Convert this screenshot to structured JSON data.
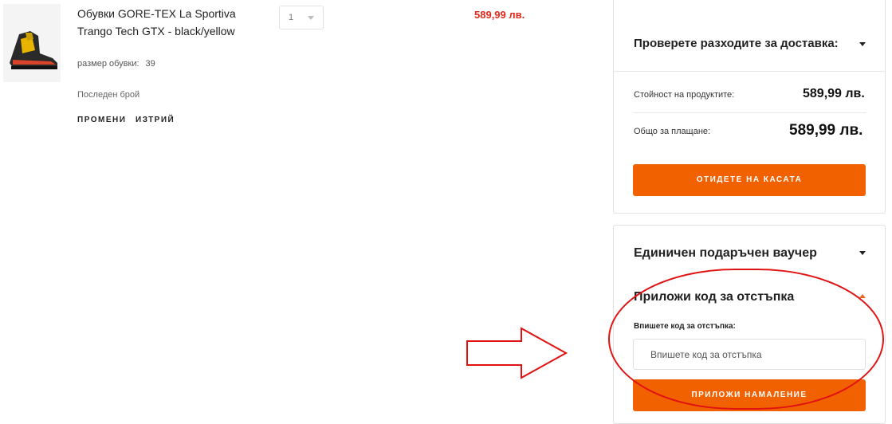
{
  "product": {
    "image_icon": "hiking-boot-icon",
    "name": "Обувки GORE-TEX La Sportiva Trango Tech GTX - black/yellow",
    "size_label": "размер обувки:",
    "size_value": "39",
    "stock_note": "Последен брой",
    "edit_label": "ПРОМЕНИ",
    "delete_label": "ИЗТРИЙ",
    "quantity": "1",
    "price": "589,99 лв."
  },
  "summary": {
    "shipping_title": "Проверете разходите за доставка:",
    "products_value_label": "Стойност на продуктите:",
    "products_value": "589,99 лв.",
    "total_label": "Общо за плащане:",
    "total_value": "589,99 лв.",
    "checkout_label": "ОТИДЕТЕ НА КАСАТА"
  },
  "voucher": {
    "gift_title": "Единичен подаръчен ваучер",
    "discount_title": "Приложи код за отстъпка",
    "input_label": "Впишете код за отстъпка:",
    "input_placeholder": "Впишете код за отстъпка",
    "apply_label": "ПРИЛОЖИ НАМАЛЕНИЕ"
  },
  "colors": {
    "accent": "#f26100",
    "price_red": "#e0291c",
    "annotation_red": "#e01212"
  }
}
